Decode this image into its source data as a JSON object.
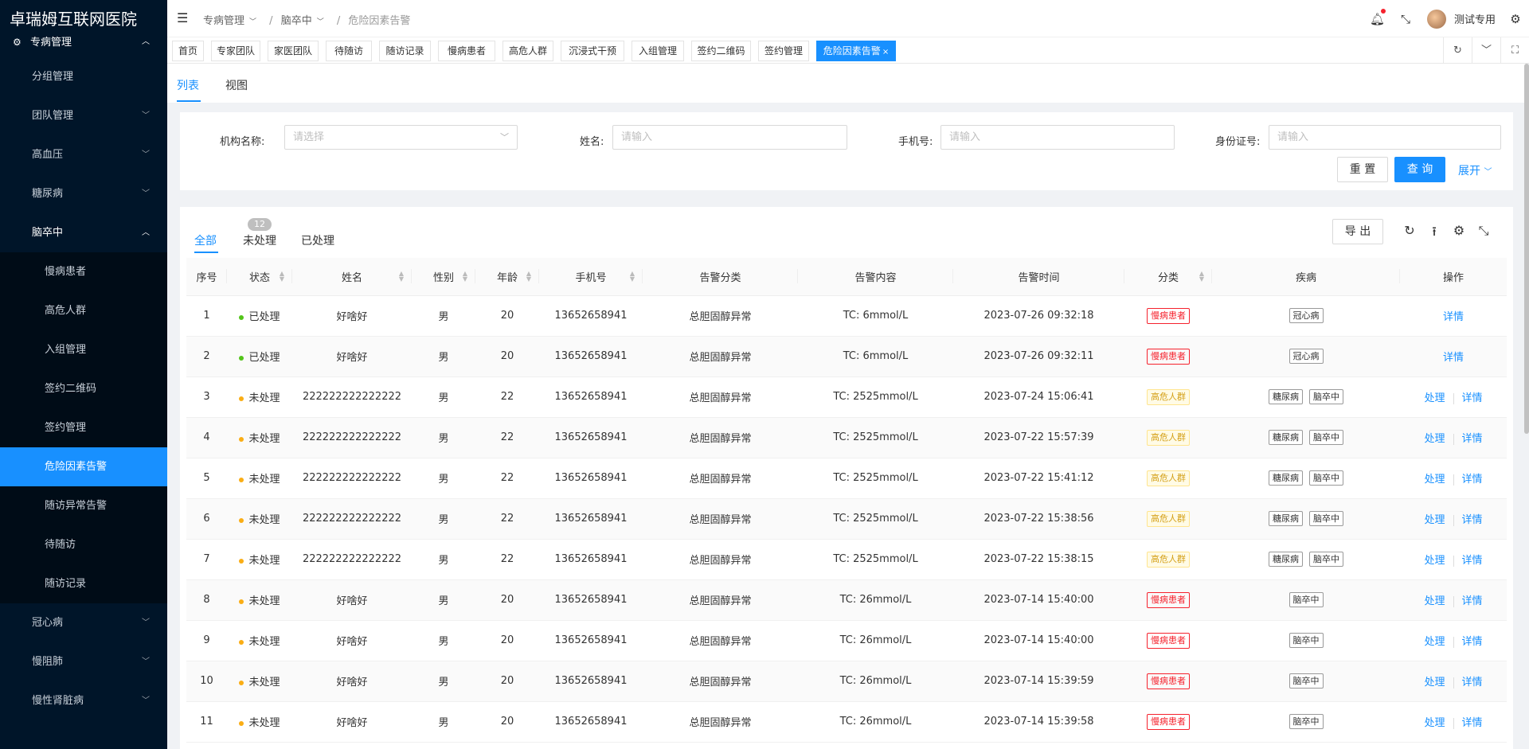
{
  "app": {
    "title": "卓瑞姆互联网医院"
  },
  "sidebar": {
    "top": {
      "label": "专病管理",
      "icon": "settings-icon"
    },
    "items": [
      {
        "label": "分组管理",
        "kind": "plain"
      },
      {
        "label": "团队管理",
        "kind": "collapsed"
      },
      {
        "label": "高血压",
        "kind": "collapsed"
      },
      {
        "label": "糖尿病",
        "kind": "collapsed"
      },
      {
        "label": "脑卒中",
        "kind": "open"
      },
      {
        "label": "慢病患者",
        "kind": "sub"
      },
      {
        "label": "高危人群",
        "kind": "sub"
      },
      {
        "label": "入组管理",
        "kind": "sub"
      },
      {
        "label": "签约二维码",
        "kind": "sub"
      },
      {
        "label": "签约管理",
        "kind": "sub"
      },
      {
        "label": "危险因素告警",
        "kind": "active"
      },
      {
        "label": "随访异常告警",
        "kind": "sub"
      },
      {
        "label": "待随访",
        "kind": "sub"
      },
      {
        "label": "随访记录",
        "kind": "sub"
      },
      {
        "label": "冠心病",
        "kind": "collapsed"
      },
      {
        "label": "慢阻肺",
        "kind": "collapsed"
      },
      {
        "label": "慢性肾脏病",
        "kind": "collapsed"
      }
    ]
  },
  "header": {
    "breadcrumb": [
      "专病管理",
      "脑卒中",
      "危险因素告警"
    ],
    "username": "测试专用"
  },
  "tabs": [
    "首页",
    "专家团队",
    "家医团队",
    "待随访",
    "随访记录",
    "慢病患者",
    "高危人群",
    "沉浸式干预",
    "入组管理",
    "签约二维码",
    "签约管理",
    "危险因素告警"
  ],
  "subtabs": {
    "list": "列表",
    "view": "视图"
  },
  "filter": {
    "org_label": "机构名称:",
    "org_placeholder": "请选择",
    "name_label": "姓名:",
    "name_placeholder": "请输入",
    "phone_label": "手机号:",
    "phone_placeholder": "请输入",
    "id_label": "身份证号:",
    "id_placeholder": "请输入",
    "reset": "重 置",
    "query": "查 询",
    "expand": "展开"
  },
  "status_tabs": {
    "all": "全部",
    "pending": "未处理",
    "pending_count": "12",
    "done": "已处理"
  },
  "toolbar": {
    "export": "导 出"
  },
  "table": {
    "headers": [
      "序号",
      "状态",
      "姓名",
      "性别",
      "年龄",
      "手机号",
      "告警分类",
      "告警内容",
      "告警时间",
      "分类",
      "疾病",
      "操作"
    ],
    "actions": {
      "process": "处理",
      "detail": "详情"
    },
    "rows": [
      {
        "no": "1",
        "status": "已处理",
        "name": "好啥好",
        "sex": "男",
        "age": "20",
        "phone": "13652658941",
        "category": "总胆固醇异常",
        "content": "TC: 6mmol/L",
        "time": "2023-07-26 09:32:18",
        "type": "慢病患者",
        "diseases": [
          "冠心病"
        ]
      },
      {
        "no": "2",
        "status": "已处理",
        "name": "好啥好",
        "sex": "男",
        "age": "20",
        "phone": "13652658941",
        "category": "总胆固醇异常",
        "content": "TC: 6mmol/L",
        "time": "2023-07-26 09:32:11",
        "type": "慢病患者",
        "diseases": [
          "冠心病"
        ]
      },
      {
        "no": "3",
        "status": "未处理",
        "name": "222222222222222",
        "sex": "男",
        "age": "22",
        "phone": "13652658941",
        "category": "总胆固醇异常",
        "content": "TC: 2525mmol/L",
        "time": "2023-07-24 15:06:41",
        "type": "高危人群",
        "diseases": [
          "糖尿病",
          "脑卒中"
        ]
      },
      {
        "no": "4",
        "status": "未处理",
        "name": "222222222222222",
        "sex": "男",
        "age": "22",
        "phone": "13652658941",
        "category": "总胆固醇异常",
        "content": "TC: 2525mmol/L",
        "time": "2023-07-22 15:57:39",
        "type": "高危人群",
        "diseases": [
          "糖尿病",
          "脑卒中"
        ]
      },
      {
        "no": "5",
        "status": "未处理",
        "name": "222222222222222",
        "sex": "男",
        "age": "22",
        "phone": "13652658941",
        "category": "总胆固醇异常",
        "content": "TC: 2525mmol/L",
        "time": "2023-07-22 15:41:12",
        "type": "高危人群",
        "diseases": [
          "糖尿病",
          "脑卒中"
        ]
      },
      {
        "no": "6",
        "status": "未处理",
        "name": "222222222222222",
        "sex": "男",
        "age": "22",
        "phone": "13652658941",
        "category": "总胆固醇异常",
        "content": "TC: 2525mmol/L",
        "time": "2023-07-22 15:38:56",
        "type": "高危人群",
        "diseases": [
          "糖尿病",
          "脑卒中"
        ]
      },
      {
        "no": "7",
        "status": "未处理",
        "name": "222222222222222",
        "sex": "男",
        "age": "22",
        "phone": "13652658941",
        "category": "总胆固醇异常",
        "content": "TC: 2525mmol/L",
        "time": "2023-07-22 15:38:15",
        "type": "高危人群",
        "diseases": [
          "糖尿病",
          "脑卒中"
        ]
      },
      {
        "no": "8",
        "status": "未处理",
        "name": "好啥好",
        "sex": "男",
        "age": "20",
        "phone": "13652658941",
        "category": "总胆固醇异常",
        "content": "TC: 26mmol/L",
        "time": "2023-07-14 15:40:00",
        "type": "慢病患者",
        "diseases": [
          "脑卒中"
        ]
      },
      {
        "no": "9",
        "status": "未处理",
        "name": "好啥好",
        "sex": "男",
        "age": "20",
        "phone": "13652658941",
        "category": "总胆固醇异常",
        "content": "TC: 26mmol/L",
        "time": "2023-07-14 15:40:00",
        "type": "慢病患者",
        "diseases": [
          "脑卒中"
        ]
      },
      {
        "no": "10",
        "status": "未处理",
        "name": "好啥好",
        "sex": "男",
        "age": "20",
        "phone": "13652658941",
        "category": "总胆固醇异常",
        "content": "TC: 26mmol/L",
        "time": "2023-07-14 15:39:59",
        "type": "慢病患者",
        "diseases": [
          "脑卒中"
        ]
      },
      {
        "no": "11",
        "status": "未处理",
        "name": "好啥好",
        "sex": "男",
        "age": "20",
        "phone": "13652658941",
        "category": "总胆固醇异常",
        "content": "TC: 26mmol/L",
        "time": "2023-07-14 15:39:58",
        "type": "慢病患者",
        "diseases": [
          "脑卒中"
        ]
      }
    ]
  },
  "colors": {
    "primary": "#1890ff",
    "sidebar": "#001529",
    "done_dot": "#52c41a",
    "pending_dot": "#faad14",
    "danger": "#f5222d"
  }
}
